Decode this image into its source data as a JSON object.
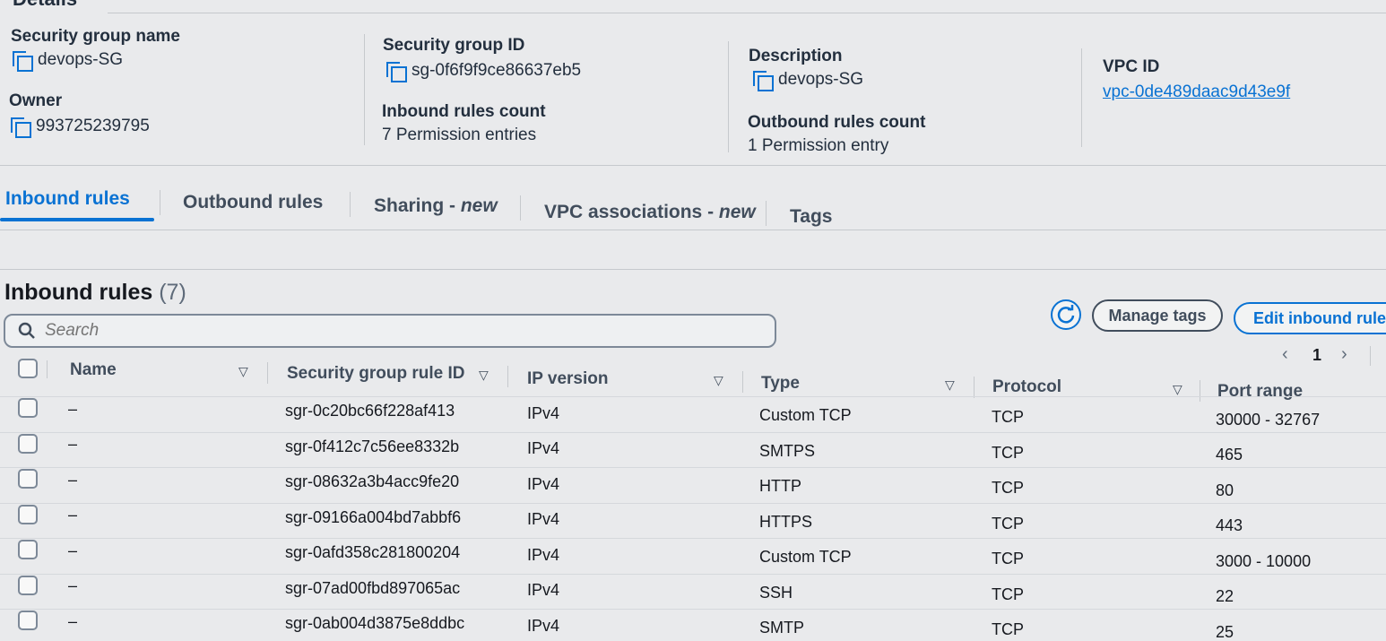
{
  "details": {
    "heading": "Details",
    "sg_name_label": "Security group name",
    "sg_name_value": "devops-SG",
    "sg_id_label": "Security group ID",
    "sg_id_value": "sg-0f6f9f9ce86637eb5",
    "description_label": "Description",
    "description_value": "devops-SG",
    "vpc_id_label": "VPC ID",
    "vpc_id_value": "vpc-0de489daac9d43e9f",
    "owner_label": "Owner",
    "owner_value": "993725239795",
    "inbound_count_label": "Inbound rules count",
    "inbound_count_value": "7 Permission entries",
    "outbound_count_label": "Outbound rules count",
    "outbound_count_value": "1 Permission entry"
  },
  "tabs": [
    {
      "label": "Inbound rules",
      "active": true
    },
    {
      "label": "Outbound rules",
      "active": false
    },
    {
      "label": "Sharing - ",
      "italic": "new"
    },
    {
      "label": "VPC associations - ",
      "italic": "new"
    },
    {
      "label": "Tags",
      "active": false
    }
  ],
  "inbound": {
    "title": "Inbound rules",
    "count": "(7)",
    "search_placeholder": "Search",
    "manage_tags": "Manage tags",
    "edit_rules": "Edit inbound rules",
    "page_number": "1",
    "columns": {
      "name": "Name",
      "rule_id": "Security group rule ID",
      "ip_version": "IP version",
      "type": "Type",
      "protocol": "Protocol",
      "port_range": "Port range"
    },
    "rows": [
      {
        "name": "–",
        "rule_id": "sgr-0c20bc66f228af413",
        "ip_version": "IPv4",
        "type": "Custom TCP",
        "protocol": "TCP",
        "port_range": "30000 - 32767"
      },
      {
        "name": "–",
        "rule_id": "sgr-0f412c7c56ee8332b",
        "ip_version": "IPv4",
        "type": "SMTPS",
        "protocol": "TCP",
        "port_range": "465"
      },
      {
        "name": "–",
        "rule_id": "sgr-08632a3b4acc9fe20",
        "ip_version": "IPv4",
        "type": "HTTP",
        "protocol": "TCP",
        "port_range": "80"
      },
      {
        "name": "–",
        "rule_id": "sgr-09166a004bd7abbf6",
        "ip_version": "IPv4",
        "type": "HTTPS",
        "protocol": "TCP",
        "port_range": "443"
      },
      {
        "name": "–",
        "rule_id": "sgr-0afd358c281800204",
        "ip_version": "IPv4",
        "type": "Custom TCP",
        "protocol": "TCP",
        "port_range": "3000 - 10000"
      },
      {
        "name": "–",
        "rule_id": "sgr-07ad00fbd897065ac",
        "ip_version": "IPv4",
        "type": "SSH",
        "protocol": "TCP",
        "port_range": "22"
      },
      {
        "name": "–",
        "rule_id": "sgr-0ab004d3875e8ddbc",
        "ip_version": "IPv4",
        "type": "SMTP",
        "protocol": "TCP",
        "port_range": "25"
      }
    ]
  },
  "icons": {
    "copy": "copy-icon",
    "search": "search-icon",
    "refresh": "refresh-icon",
    "sort": "sort-down-icon",
    "prev": "chevron-left-icon",
    "next": "chevron-right-icon"
  },
  "colors": {
    "accent": "#0972d3",
    "background": "#e9eaec",
    "text": "#16191f"
  }
}
